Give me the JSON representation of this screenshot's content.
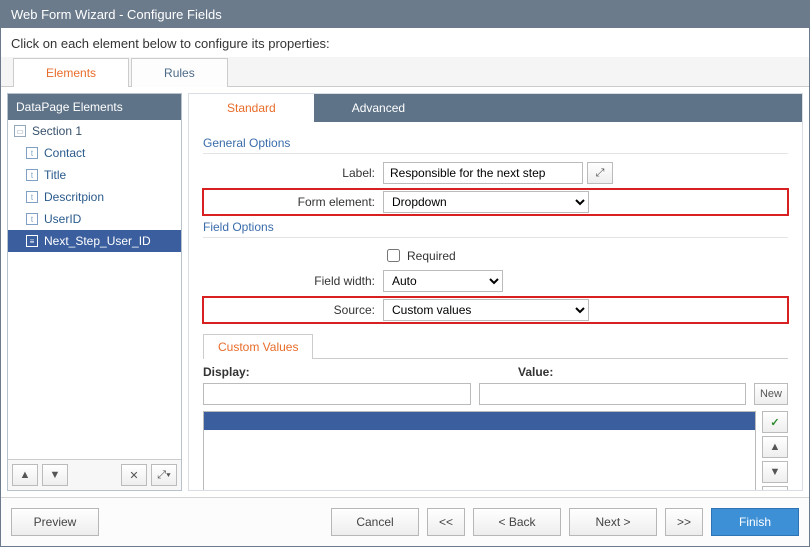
{
  "title": "Web Form Wizard - Configure Fields",
  "instruction": "Click on each element below to configure its properties:",
  "topTabs": {
    "elements": "Elements",
    "rules": "Rules"
  },
  "leftPanel": {
    "header": "DataPage Elements",
    "items": [
      {
        "label": "Section 1",
        "kind": "section"
      },
      {
        "label": "Contact",
        "kind": "field"
      },
      {
        "label": "Title",
        "kind": "field"
      },
      {
        "label": "Descritpion",
        "kind": "field"
      },
      {
        "label": "UserID",
        "kind": "field"
      },
      {
        "label": "Next_Step_User_ID",
        "kind": "field",
        "selected": true
      }
    ]
  },
  "innerTabs": {
    "standard": "Standard",
    "advanced": "Advanced"
  },
  "sections": {
    "general": "General Options",
    "field": "Field Options"
  },
  "form": {
    "label_label": "Label:",
    "label_value": "Responsible for the next step",
    "form_element_label": "Form element:",
    "form_element_value": "Dropdown",
    "required_label": "Required",
    "field_width_label": "Field width:",
    "field_width_value": "Auto",
    "source_label": "Source:",
    "source_value": "Custom values"
  },
  "customValues": {
    "tab": "Custom Values",
    "display_label": "Display:",
    "value_label": "Value:",
    "new_btn": "New"
  },
  "footer": {
    "preview": "Preview",
    "cancel": "Cancel",
    "prev_all": "<<",
    "back": "< Back",
    "next": "Next >",
    "next_all": ">>",
    "finish": "Finish"
  }
}
